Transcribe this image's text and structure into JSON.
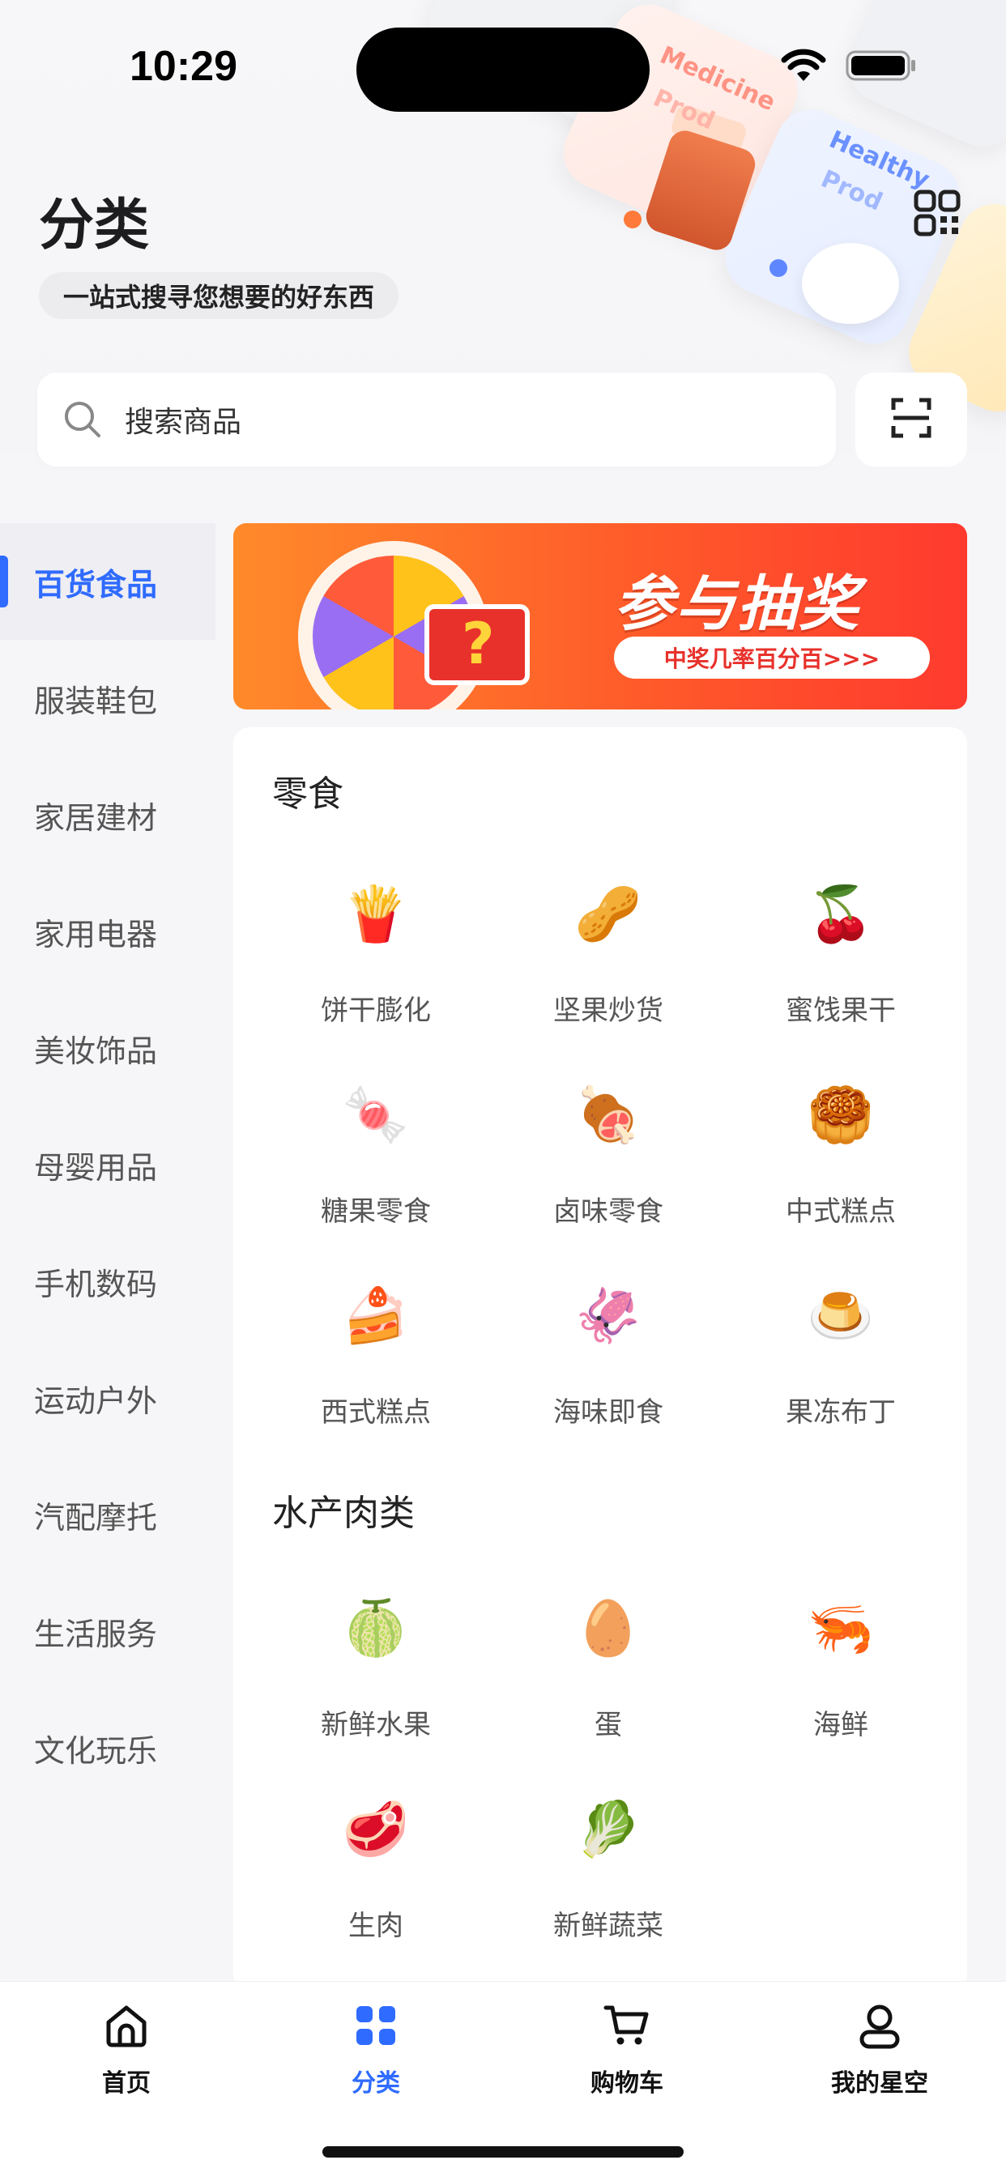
{
  "status_bar": {
    "time": "10:29"
  },
  "header": {
    "title": "分类",
    "subtitle": "一站式搜寻您想要的好东西",
    "deco_texts": [
      "Medicine",
      "Prod",
      "Healthy",
      "Prod"
    ]
  },
  "search": {
    "placeholder": "搜索商品"
  },
  "sidebar": {
    "items": [
      {
        "label": "百货食品",
        "active": true
      },
      {
        "label": "服装鞋包"
      },
      {
        "label": "家居建材"
      },
      {
        "label": "家用电器"
      },
      {
        "label": "美妆饰品"
      },
      {
        "label": "母婴用品"
      },
      {
        "label": "手机数码"
      },
      {
        "label": "运动户外"
      },
      {
        "label": "汽配摩托"
      },
      {
        "label": "生活服务"
      },
      {
        "label": "文化玩乐"
      }
    ]
  },
  "banner": {
    "title": "参与抽奖",
    "pill": "中奖几率百分百>>>"
  },
  "sections": [
    {
      "title": "零食",
      "items": [
        {
          "label": "饼干膨化",
          "icon": "chips-icon",
          "emoji": "🍟"
        },
        {
          "label": "坚果炒货",
          "icon": "nuts-icon",
          "emoji": "🥜"
        },
        {
          "label": "蜜饯果干",
          "icon": "dried-fruit-icon",
          "emoji": "🍒"
        },
        {
          "label": "糖果零食",
          "icon": "candy-icon",
          "emoji": "🍬"
        },
        {
          "label": "卤味零食",
          "icon": "braised-snack-icon",
          "emoji": "🍖"
        },
        {
          "label": "中式糕点",
          "icon": "chinese-pastry-icon",
          "emoji": "🥮"
        },
        {
          "label": "西式糕点",
          "icon": "western-pastry-icon",
          "emoji": "🍰"
        },
        {
          "label": "海味即食",
          "icon": "seafood-snack-icon",
          "emoji": "🦑"
        },
        {
          "label": "果冻布丁",
          "icon": "jelly-icon",
          "emoji": "🍮"
        }
      ]
    },
    {
      "title": "水产肉类",
      "items": [
        {
          "label": "新鲜水果",
          "icon": "melon-icon",
          "emoji": "🍈"
        },
        {
          "label": "蛋",
          "icon": "egg-icon",
          "emoji": "🥚"
        },
        {
          "label": "海鲜",
          "icon": "shrimp-icon",
          "emoji": "🦐"
        },
        {
          "label": "生肉",
          "icon": "raw-meat-icon",
          "emoji": "🥩"
        },
        {
          "label": "新鲜蔬菜",
          "icon": "vegetable-icon",
          "emoji": "🥬"
        }
      ]
    }
  ],
  "tabbar": {
    "tabs": [
      {
        "label": "首页",
        "icon": "home-icon"
      },
      {
        "label": "分类",
        "icon": "category-icon",
        "active": true
      },
      {
        "label": "购物车",
        "icon": "cart-icon"
      },
      {
        "label": "我的星空",
        "icon": "profile-icon"
      }
    ]
  },
  "colors": {
    "accent": "#2f6bff",
    "banner": "#ff5b2a"
  }
}
